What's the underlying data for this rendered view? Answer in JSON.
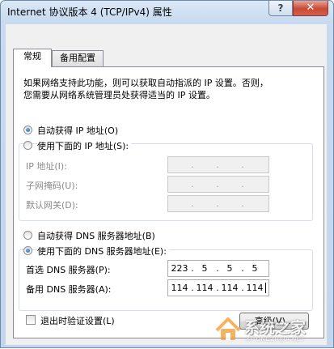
{
  "window": {
    "title": "Internet 协议版本 4 (TCP/IPv4) 属性",
    "help_glyph": "?",
    "close_glyph": "✕"
  },
  "tabs": [
    {
      "label": "常规",
      "active": true
    },
    {
      "label": "备用配置",
      "active": false
    }
  ],
  "description": {
    "line1": "如果网络支持此功能，则可以获取自动指派的 IP 设置。否则，",
    "line2": "您需要从网络系统管理员处获得适当的 IP 设置。"
  },
  "ip_mode": {
    "auto_label": "自动获得 IP 地址(O)",
    "auto_checked": true,
    "manual_label": "使用下面的 IP 地址(S):",
    "manual_checked": false
  },
  "ip_fields": [
    {
      "label": "IP 地址(I):",
      "value": [
        "",
        "",
        "",
        ""
      ],
      "enabled": false
    },
    {
      "label": "子网掩码(U):",
      "value": [
        "",
        "",
        "",
        ""
      ],
      "enabled": false
    },
    {
      "label": "默认网关(D):",
      "value": [
        "",
        "",
        "",
        ""
      ],
      "enabled": false
    }
  ],
  "dns_mode": {
    "auto_label": "自动获得 DNS 服务器地址(B)",
    "auto_checked": false,
    "manual_label": "使用下面的 DNS 服务器地址(E):",
    "manual_checked": true
  },
  "dns_fields": [
    {
      "label": "首选 DNS 服务器(P):",
      "value": [
        "223",
        "5",
        "5",
        "5"
      ],
      "enabled": true
    },
    {
      "label": "备用 DNS 服务器(A):",
      "value": [
        "114",
        "114",
        "114",
        "114"
      ],
      "enabled": true
    }
  ],
  "validate_on_exit": {
    "label": "退出时验证设置(L)",
    "checked": false
  },
  "advanced_button": {
    "label": "高级(V)..."
  },
  "watermark": {
    "text": "系统之家",
    "subtext": "XITONGZHIJIA.NET"
  },
  "colors": {
    "title_gradient_top": "#dbe8f6",
    "close_red": "#c74a36",
    "radio_selected": "#1c5aa6",
    "watermark_orange": "#f29a2e"
  }
}
